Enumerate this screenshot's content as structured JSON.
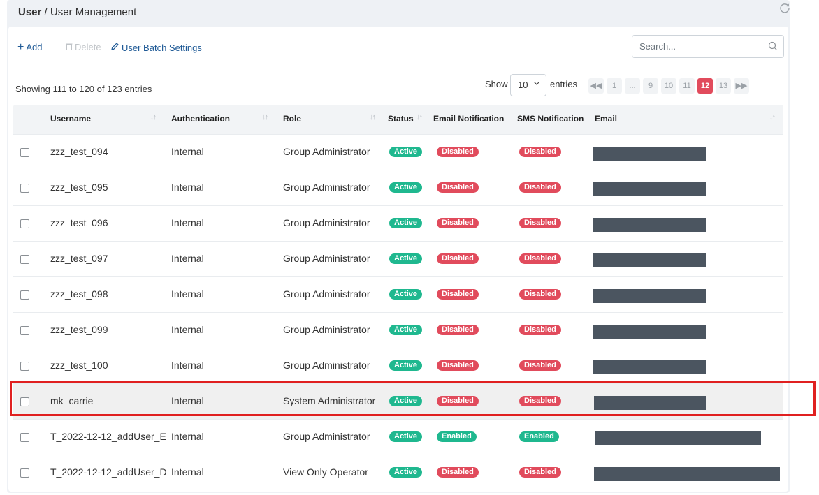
{
  "breadcrumb": {
    "root": "User",
    "separator": "/",
    "current": "User Management"
  },
  "toolbar": {
    "add_label": "Add",
    "delete_label": "Delete",
    "batch_label": "User Batch Settings"
  },
  "search": {
    "placeholder": "Search..."
  },
  "info": {
    "showing": "Showing 111 to 120 of 123 entries"
  },
  "length": {
    "show_label": "Show",
    "value": "10",
    "entries_label": "entries"
  },
  "pagination": {
    "pages": [
      "1",
      "...",
      "9",
      "10",
      "11",
      "12",
      "13"
    ],
    "active": "12"
  },
  "columns": {
    "username": "Username",
    "authentication": "Authentication",
    "role": "Role",
    "status": "Status",
    "email_notification": "Email Notification",
    "sms_notification": "SMS Notification",
    "email": "Email"
  },
  "rows": [
    {
      "username": "zzz_test_094",
      "auth": "Internal",
      "role": "Group Administrator",
      "status": "Active",
      "email_notif": "Disabled",
      "sms_notif": "Disabled"
    },
    {
      "username": "zzz_test_095",
      "auth": "Internal",
      "role": "Group Administrator",
      "status": "Active",
      "email_notif": "Disabled",
      "sms_notif": "Disabled"
    },
    {
      "username": "zzz_test_096",
      "auth": "Internal",
      "role": "Group Administrator",
      "status": "Active",
      "email_notif": "Disabled",
      "sms_notif": "Disabled"
    },
    {
      "username": "zzz_test_097",
      "auth": "Internal",
      "role": "Group Administrator",
      "status": "Active",
      "email_notif": "Disabled",
      "sms_notif": "Disabled"
    },
    {
      "username": "zzz_test_098",
      "auth": "Internal",
      "role": "Group Administrator",
      "status": "Active",
      "email_notif": "Disabled",
      "sms_notif": "Disabled"
    },
    {
      "username": "zzz_test_099",
      "auth": "Internal",
      "role": "Group Administrator",
      "status": "Active",
      "email_notif": "Disabled",
      "sms_notif": "Disabled"
    },
    {
      "username": "zzz_test_100",
      "auth": "Internal",
      "role": "Group Administrator",
      "status": "Active",
      "email_notif": "Disabled",
      "sms_notif": "Disabled"
    },
    {
      "username": "mk_carrie",
      "auth": "Internal",
      "role": "System Administrator",
      "status": "Active",
      "email_notif": "Disabled",
      "sms_notif": "Disabled"
    },
    {
      "username": "T_2022-12-12_addUser_E",
      "auth": "Internal",
      "role": "Group Administrator",
      "status": "Active",
      "email_notif": "Enabled",
      "sms_notif": "Enabled"
    },
    {
      "username": "T_2022-12-12_addUser_D",
      "auth": "Internal",
      "role": "View Only Operator",
      "status": "Active",
      "email_notif": "Disabled",
      "sms_notif": "Disabled"
    }
  ],
  "colors": {
    "accent": "#1f5a96",
    "active": "#1fb88f",
    "disabled": "#e14b5c",
    "highlight": "#e02020",
    "redacted": "#4b5560"
  }
}
